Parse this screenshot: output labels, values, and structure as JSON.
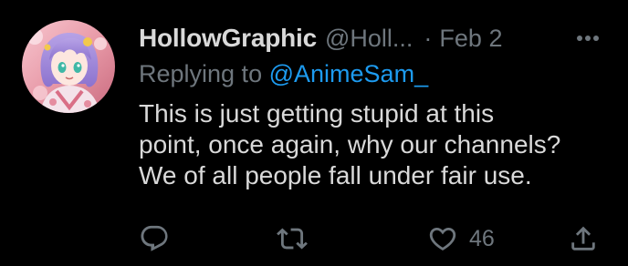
{
  "tweet": {
    "display_name": "HollowGraphic",
    "handle": "@Holl...",
    "separator": "·",
    "date": "Feb 2",
    "replying_prefix": "Replying to",
    "replying_to": "@AnimeSam_",
    "body_lines": [
      "This is just getting stupid at this",
      "point, once again, why our channels?",
      "We of all people fall under fair use."
    ],
    "actions": {
      "reply_icon": "reply-icon",
      "retweet_icon": "retweet-icon",
      "like_icon": "like-icon",
      "like_count": "46",
      "share_icon": "share-icon"
    },
    "more_icon": "more-icon"
  },
  "colors": {
    "background": "#000000",
    "primary_text": "#d9d9d9",
    "secondary_text": "#6e767d",
    "accent": "#1d9bf0"
  }
}
